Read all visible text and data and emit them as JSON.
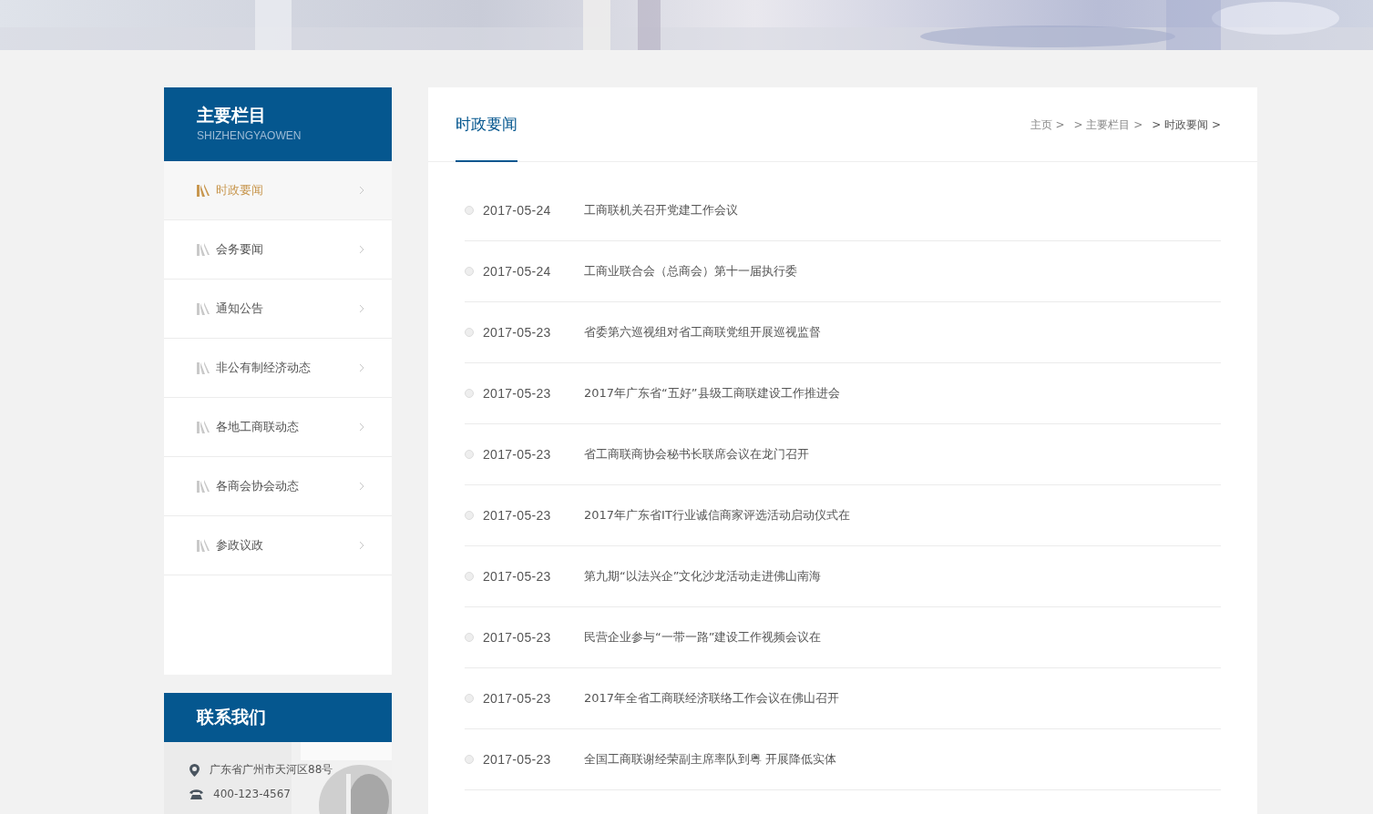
{
  "sidebar": {
    "title": "主要栏目",
    "subtitle": "SHIZHENGYAOWEN",
    "items": [
      {
        "label": "时政要闻",
        "selected": true
      },
      {
        "label": "会务要闻",
        "selected": false
      },
      {
        "label": "通知公告",
        "selected": false
      },
      {
        "label": "非公有制经济动态",
        "selected": false
      },
      {
        "label": "各地工商联动态",
        "selected": false
      },
      {
        "label": "各商会协会动态",
        "selected": false
      },
      {
        "label": "参政议政",
        "selected": false
      }
    ]
  },
  "contact": {
    "title": "联系我们",
    "address": "广东省广州市天河区88号",
    "phone": "400-123-4567"
  },
  "main": {
    "title": "时政要闻",
    "breadcrumb": [
      "主页 >",
      "> 主要栏目 >",
      "> 时政要闻 >"
    ],
    "news": [
      {
        "date": "2017-05-24",
        "title": "工商联机关召开党建工作会议"
      },
      {
        "date": "2017-05-24",
        "title": "工商业联合会（总商会）第十一届执行委"
      },
      {
        "date": "2017-05-23",
        "title": "省委第六巡视组对省工商联党组开展巡视监督"
      },
      {
        "date": "2017-05-23",
        "title": "2017年广东省“五好”县级工商联建设工作推进会"
      },
      {
        "date": "2017-05-23",
        "title": "省工商联商协会秘书长联席会议在龙门召开"
      },
      {
        "date": "2017-05-23",
        "title": "2017年广东省IT行业诚信商家评选活动启动仪式在"
      },
      {
        "date": "2017-05-23",
        "title": "第九期“以法兴企”文化沙龙活动走进佛山南海"
      },
      {
        "date": "2017-05-23",
        "title": "民营企业参与“一带一路”建设工作视频会议在"
      },
      {
        "date": "2017-05-23",
        "title": "2017年全省工商联经济联络工作会议在佛山召开"
      },
      {
        "date": "2017-05-23",
        "title": "全国工商联谢经荣副主席率队到粤 开展降低实体"
      }
    ]
  }
}
